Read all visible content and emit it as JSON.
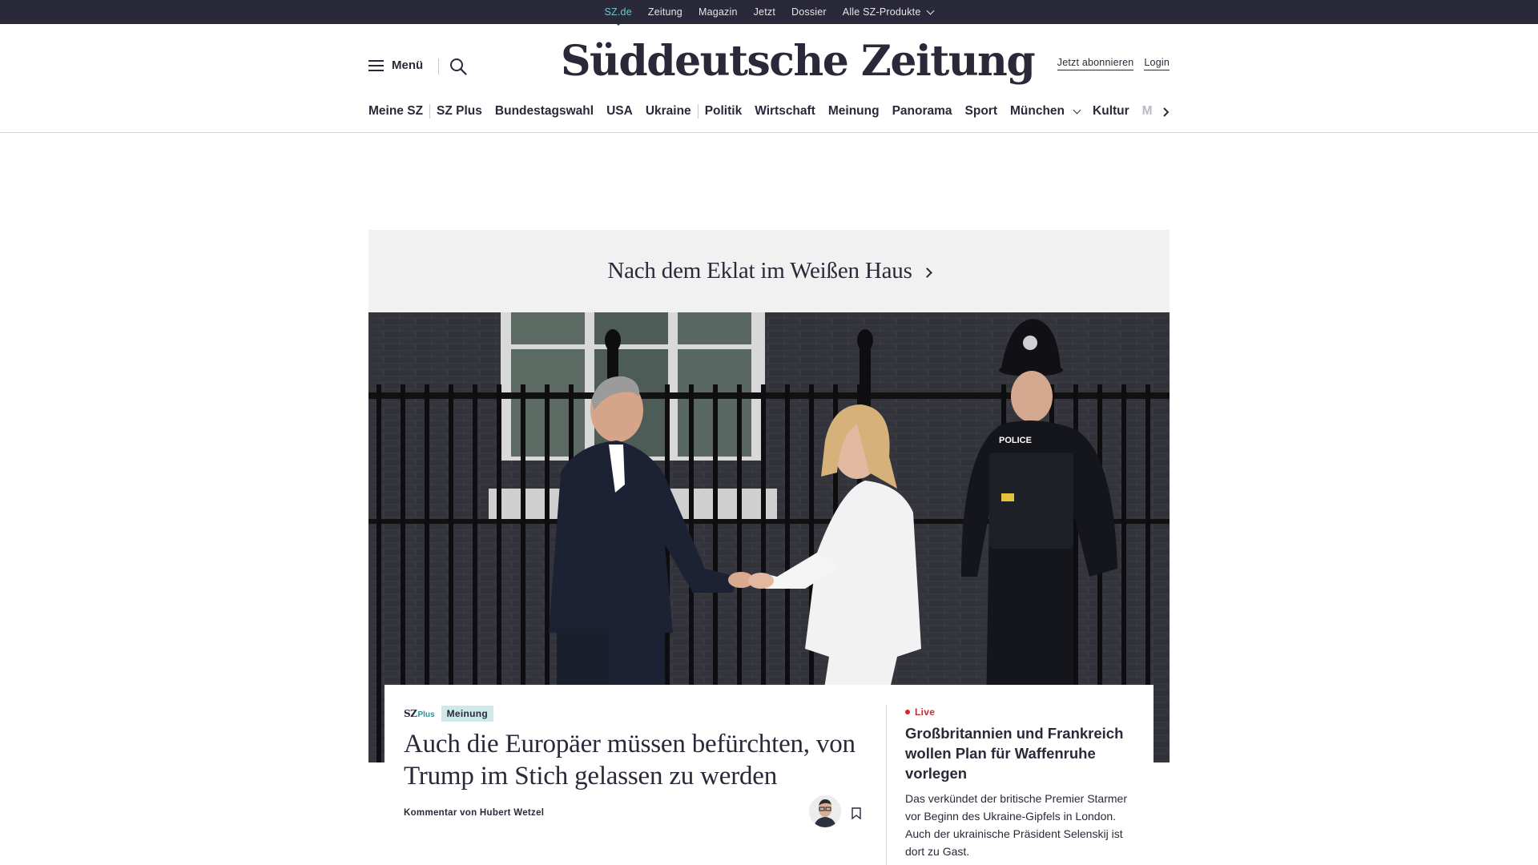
{
  "topbar": {
    "items": [
      {
        "label": "SZ.de"
      },
      {
        "label": "Zeitung"
      },
      {
        "label": "Magazin"
      },
      {
        "label": "Jetzt"
      },
      {
        "label": "Dossier"
      },
      {
        "label": "Alle SZ-Produkte"
      }
    ]
  },
  "header": {
    "menu_label": "Menü",
    "logo": "Süddeutsche Zeitung",
    "subscribe": "Jetzt abonnieren",
    "login": "Login"
  },
  "nav": {
    "items": [
      {
        "label": "Meine SZ"
      },
      {
        "label": "SZ Plus"
      },
      {
        "label": "Bundestagswahl"
      },
      {
        "label": "USA"
      },
      {
        "label": "Ukraine"
      },
      {
        "label": "Politik"
      },
      {
        "label": "Wirtschaft"
      },
      {
        "label": "Meinung"
      },
      {
        "label": "Panorama"
      },
      {
        "label": "Sport"
      },
      {
        "label": "München"
      },
      {
        "label": "Kultur"
      },
      {
        "label": "M"
      }
    ]
  },
  "teaser": {
    "title": "Nach dem Eklat im Weißen Haus"
  },
  "lead": {
    "brand_sz": "SZ",
    "brand_plus": "Plus",
    "tag": "Meinung",
    "headline": "Auch die Europäer müssen befürchten, von Trump im Stich gelassen zu werden",
    "byline": "Kommentar von Hubert Wetzel"
  },
  "live": {
    "label": "Live",
    "title": "Großbritannien und Frankreich wollen Plan für Waffenruhe vorlegen",
    "text": "Das verkündet der britische Premier Starmer vor Beginn des Ukraine-Gipfels in London. Auch der ukrainische Präsident Selenskij ist dort zu Gast."
  },
  "colors": {
    "brand_dark": "#29293a",
    "accent_teal": "#71c5c9",
    "tag_bg": "#cde9ea",
    "live_red": "#d8232a"
  }
}
